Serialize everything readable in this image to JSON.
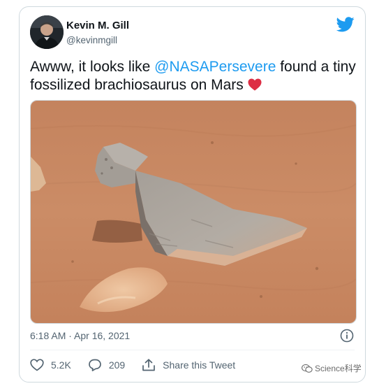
{
  "author": {
    "name": "Kevin M. Gill",
    "handle": "@kevinmgill"
  },
  "tweet": {
    "text_before": "Awww, it looks like ",
    "mention": "@NASAPersevere",
    "text_after": " found a tiny fossilized brachiosaurus on Mars ",
    "emoji": "red-heart-icon"
  },
  "meta": {
    "timestamp": "6:18 AM · Apr 16, 2021"
  },
  "actions": {
    "likes": "5.2K",
    "replies": "209",
    "share_label": "Share this Tweet"
  },
  "watermark": {
    "text": "Science科学"
  },
  "colors": {
    "twitter_blue": "#1d9bf0",
    "heart_red": "#dd2e44",
    "mars_sand": "#c98a63"
  }
}
